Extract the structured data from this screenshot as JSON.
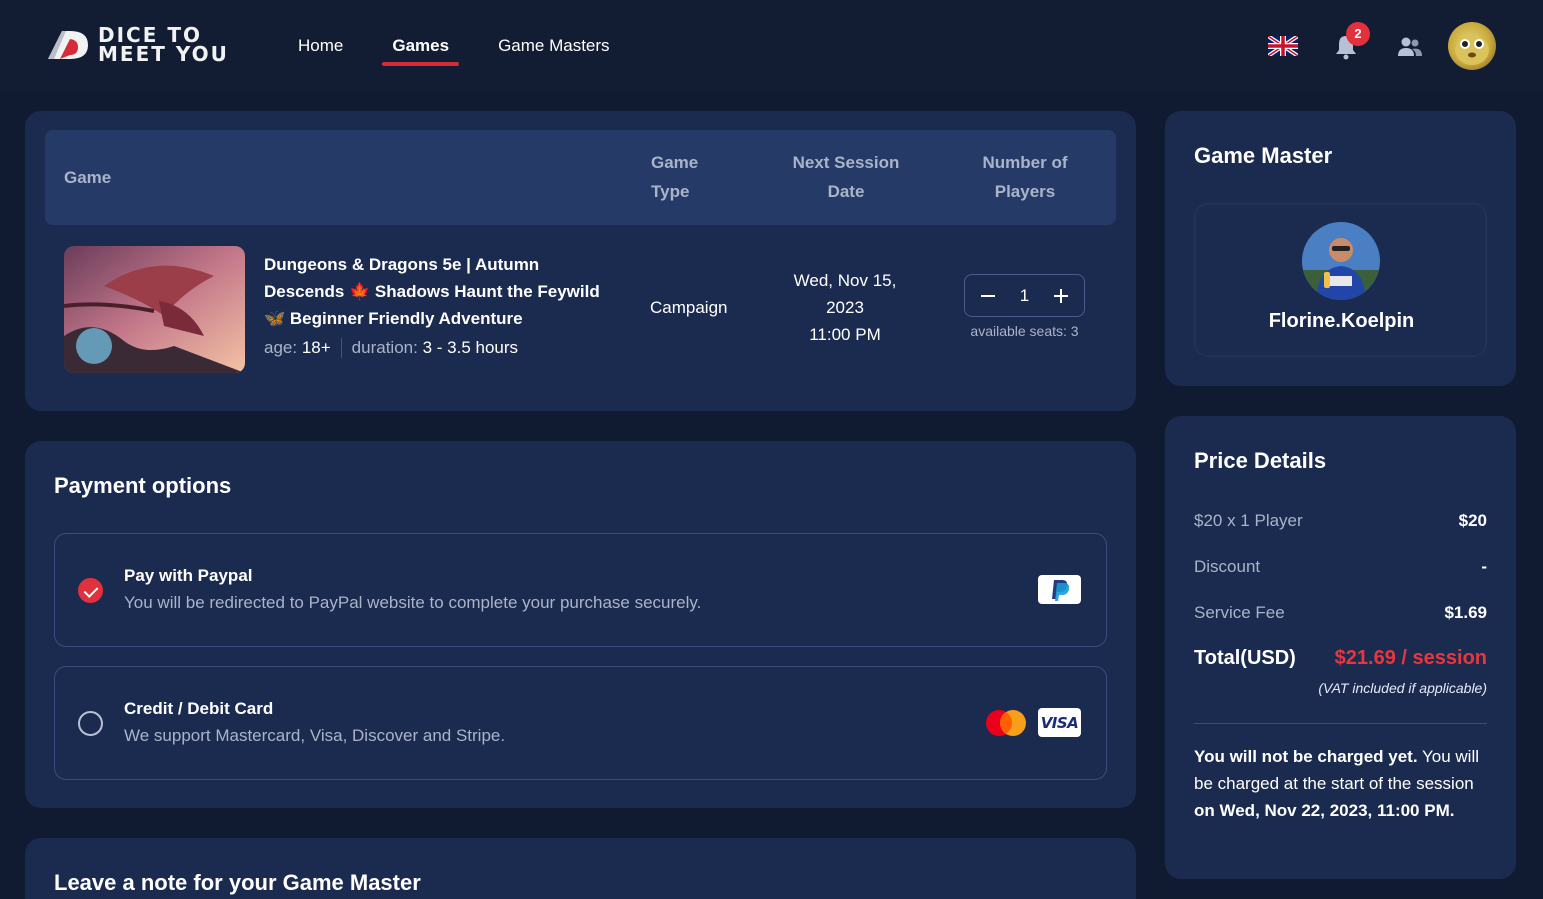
{
  "header": {
    "logo_line1": "DICE TO",
    "logo_line2": "MEET YOU",
    "nav": [
      {
        "label": "Home",
        "active": false
      },
      {
        "label": "Games",
        "active": true
      },
      {
        "label": "Game Masters",
        "active": false
      }
    ],
    "notification_count": "2",
    "accent": "#d62c3a"
  },
  "game_table": {
    "headers": {
      "game": "Game",
      "game_type": [
        "Game",
        "Type"
      ],
      "next_session": [
        "Next Session",
        "Date"
      ],
      "players": [
        "Number of",
        "Players"
      ]
    },
    "row": {
      "title_lines": [
        "Dungeons & Dragons 5e | Autumn",
        "Descends 🍁 Shadows Haunt the Feywild",
        "🦋 Beginner Friendly Adventure"
      ],
      "age_label": "age:",
      "age_value": "18+",
      "duration_label": "duration:",
      "duration_value": "3 - 3.5 hours",
      "game_type": "Campaign",
      "date_lines": [
        "Wed, Nov 15,",
        "2023",
        "11:00 PM"
      ],
      "players_count": "1",
      "available_seats": "available seats: 3"
    }
  },
  "payment": {
    "title": "Payment options",
    "options": [
      {
        "title": "Pay with Paypal",
        "desc": "You will be redirected to PayPal website to complete your purchase securely.",
        "selected": true,
        "icons": [
          "paypal-icon"
        ]
      },
      {
        "title": "Credit / Debit Card",
        "desc": "We support Mastercard, Visa, Discover and Stripe.",
        "selected": false,
        "icons": [
          "mastercard-icon",
          "visa-icon"
        ],
        "visa_text": "VISA"
      }
    ]
  },
  "note": {
    "title": "Leave a note for your Game Master"
  },
  "game_master": {
    "title": "Game Master",
    "name": "Florine.Koelpin"
  },
  "price": {
    "title": "Price Details",
    "rows": [
      {
        "label": "$20 x 1 Player",
        "value": "$20"
      },
      {
        "label": "Discount",
        "value": "-"
      },
      {
        "label": "Service Fee",
        "value": "$1.69"
      }
    ],
    "total_label": "Total(USD)",
    "total_value": "$21.69 / session",
    "vat_note": "(VAT included if applicable)",
    "charge_bold": "You will not be charged yet.",
    "charge_text": " You will be charged at the start of the session",
    "charge_date": "on Wed, Nov 22, 2023, 11:00 PM."
  }
}
